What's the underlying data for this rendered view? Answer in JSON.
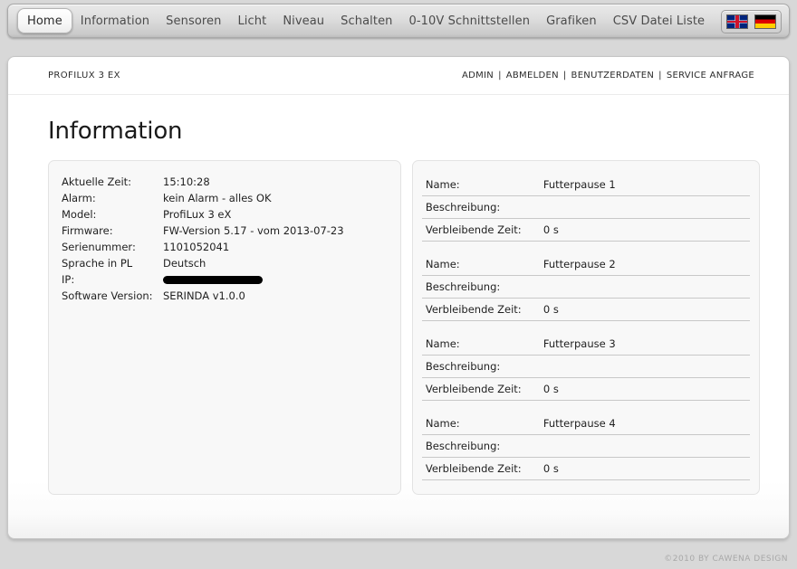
{
  "nav": {
    "items": [
      {
        "label": "Home",
        "active": true
      },
      {
        "label": "Information",
        "active": false
      },
      {
        "label": "Sensoren",
        "active": false
      },
      {
        "label": "Licht",
        "active": false
      },
      {
        "label": "Niveau",
        "active": false
      },
      {
        "label": "Schalten",
        "active": false
      },
      {
        "label": "0-10V Schnittstellen",
        "active": false
      },
      {
        "label": "Grafiken",
        "active": false
      },
      {
        "label": "CSV Datei Liste",
        "active": false
      },
      {
        "label": "?",
        "active": false
      }
    ],
    "flags": [
      {
        "name": "flag-uk-icon",
        "title": "English"
      },
      {
        "name": "flag-de-icon",
        "title": "Deutsch"
      }
    ]
  },
  "header": {
    "device": "PROFILUX 3 EX",
    "links": [
      "ADMIN",
      "ABMELDEN",
      "BENUTZERDATEN",
      "SERVICE ANFRAGE"
    ],
    "separator": "|"
  },
  "page": {
    "title": "Information"
  },
  "info": {
    "rows": [
      {
        "label": "Aktuelle Zeit:",
        "value": "15:10:28"
      },
      {
        "label": "Alarm:",
        "value": "kein Alarm - alles OK"
      },
      {
        "label": "Model:",
        "value": "ProfiLux 3 eX"
      },
      {
        "label": "Firmware:",
        "value": "FW-Version 5.17 - vom 2013-07-23"
      },
      {
        "label": "Serienummer:",
        "value": "1101052041"
      },
      {
        "label": "Sprache in PL",
        "value": "Deutsch"
      },
      {
        "label": "IP:",
        "value": "",
        "redacted": true
      },
      {
        "label": "Software Version:",
        "value": "SERINDA v1.0.0"
      }
    ]
  },
  "feeding_pauses": {
    "labels": {
      "name": "Name:",
      "description": "Beschreibung:",
      "remaining": "Verbleibende Zeit:"
    },
    "items": [
      {
        "name": "Futterpause 1",
        "description": "",
        "remaining": "0 s"
      },
      {
        "name": "Futterpause 2",
        "description": "",
        "remaining": "0 s"
      },
      {
        "name": "Futterpause 3",
        "description": "",
        "remaining": "0 s"
      },
      {
        "name": "Futterpause 4",
        "description": "",
        "remaining": "0 s"
      }
    ]
  },
  "footer": {
    "copyright": "©2010 BY CAWENA DESIGN"
  }
}
